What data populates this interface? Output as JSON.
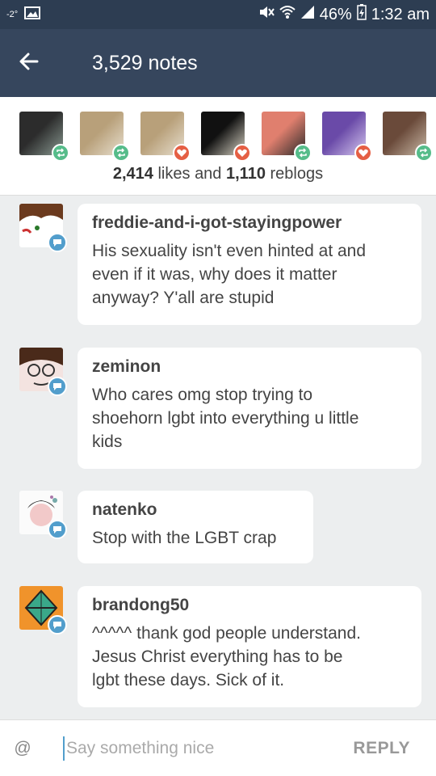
{
  "status_bar": {
    "temperature": "-2°",
    "battery": "46%",
    "time": "1:32 am"
  },
  "header": {
    "title": "3,529 notes"
  },
  "notes_summary": {
    "likes": "2,414",
    "likes_label": "likes",
    "conjunction": "and",
    "reblogs": "1,110",
    "reblogs_label": "reblogs"
  },
  "note_avatars": [
    {
      "type": "reblog",
      "colors": [
        "#2c2c2c",
        "#8a9a92"
      ]
    },
    {
      "type": "reblog",
      "colors": [
        "#b8a07a",
        "#e8e0d0"
      ]
    },
    {
      "type": "like",
      "colors": [
        "#b8a07a",
        "#e8e0d0"
      ]
    },
    {
      "type": "like",
      "colors": [
        "#111111",
        "#d9d4c4"
      ]
    },
    {
      "type": "reblog",
      "colors": [
        "#e07f6e",
        "#2a2a2a"
      ]
    },
    {
      "type": "like",
      "colors": [
        "#6a4aa8",
        "#d6c8ef"
      ]
    },
    {
      "type": "reblog",
      "colors": [
        "#6a4a3a",
        "#c9b8a6"
      ]
    }
  ],
  "replies": [
    {
      "username": "freddie-and-i-got-stayingpower",
      "lines": [
        "His sexuality isn't even hinted at and",
        "even if it was, why does it matter",
        "anyway? Y'all are stupid"
      ]
    },
    {
      "username": "zeminon",
      "lines": [
        "Who cares omg stop trying to",
        "shoehorn lgbt into everything u little",
        "kids"
      ]
    },
    {
      "username": "natenko",
      "lines": [
        "Stop with the LGBT crap"
      ]
    },
    {
      "username": "brandong50",
      "lines": [
        "^^^^^ thank god people understand.",
        "Jesus Christ everything has to be",
        "lgbt these days. Sick of it."
      ]
    }
  ],
  "composer": {
    "at_label": "@",
    "placeholder": "Say something nice",
    "reply_label": "REPLY"
  },
  "colors": {
    "app_bar": "#36465d",
    "reblog": "#56bc8a",
    "like": "#e55f44",
    "reply_badge": "#529ecc"
  }
}
